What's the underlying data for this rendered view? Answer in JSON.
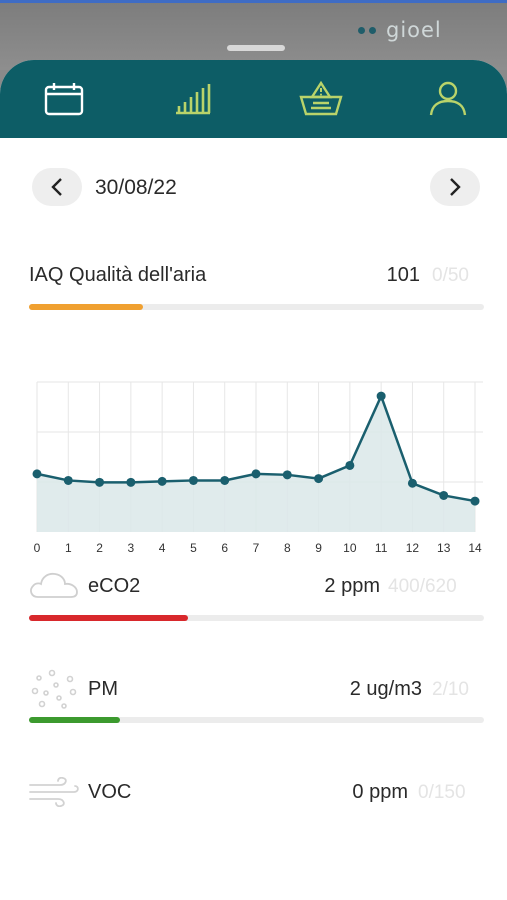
{
  "header": {
    "logo_text": "gioel"
  },
  "nav": {
    "items": [
      {
        "icon": "calendar-icon",
        "active": true
      },
      {
        "icon": "signal-bars-icon",
        "active": false
      },
      {
        "icon": "basket-warning-icon",
        "active": false
      },
      {
        "icon": "user-icon",
        "active": false
      }
    ],
    "colors": {
      "background": "#0d5d66",
      "active": "#ffffff",
      "inactive": "#b9d36a"
    }
  },
  "date": {
    "value": "30/08/22",
    "prev_icon": "chevron-left-icon",
    "next_icon": "chevron-right-icon"
  },
  "iaq": {
    "label": "IAQ Qualità dell'aria",
    "value": "101",
    "range": "0/50",
    "level": 0.25,
    "color": "#f0a030"
  },
  "chart_data": {
    "type": "line",
    "x": [
      0,
      1,
      2,
      3,
      4,
      5,
      6,
      7,
      8,
      9,
      10,
      11,
      12,
      13,
      14
    ],
    "values": [
      62,
      55,
      53,
      53,
      54,
      55,
      55,
      62,
      61,
      57,
      71,
      145,
      52,
      39,
      33
    ],
    "ylim": [
      0,
      160
    ],
    "grid": true,
    "color": "#1a5f6e"
  },
  "metrics": [
    {
      "icon": "cloud-icon",
      "label": "eCO2",
      "value": "2 ppm",
      "range": "400/620",
      "level": 0.35,
      "color": "#d8282c"
    },
    {
      "icon": "particles-icon",
      "label": "PM",
      "value": "2 ug/m3",
      "range": "2/10",
      "level": 0.2,
      "color": "#3c9a2e"
    },
    {
      "icon": "wind-icon",
      "label": "VOC",
      "value": "0 ppm",
      "range": "0/150",
      "level": 0,
      "color": "#cccccc"
    }
  ]
}
